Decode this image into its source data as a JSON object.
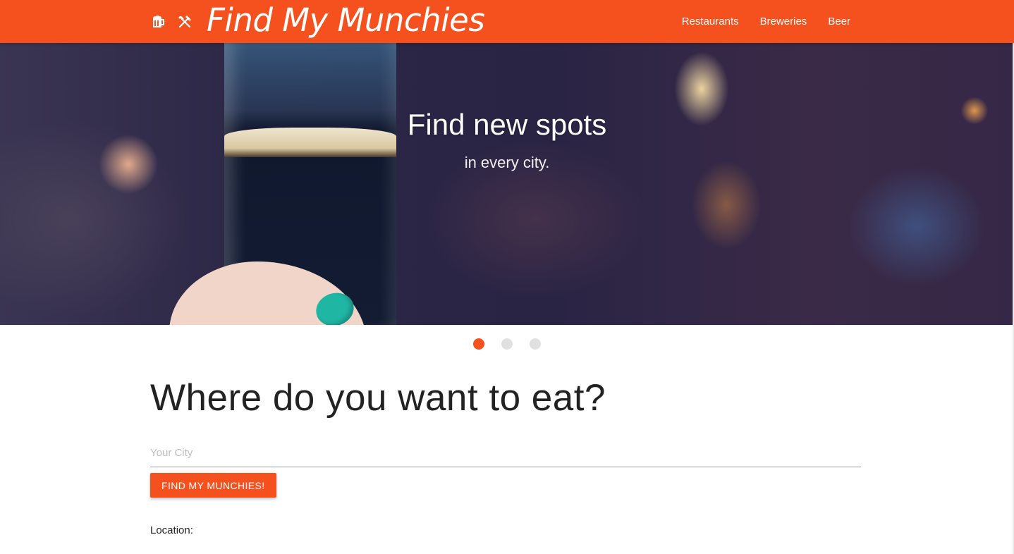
{
  "header": {
    "brand_title": "Find My Munchies",
    "brand_icons": [
      "beer-mug-icon",
      "fork-knife-icon"
    ],
    "nav": [
      {
        "label": "Restaurants"
      },
      {
        "label": "Breweries"
      },
      {
        "label": "Beer"
      }
    ]
  },
  "hero": {
    "title": "Find new spots",
    "subtitle": "in every city."
  },
  "slider": {
    "slide_count": 3,
    "active_index": 0
  },
  "search": {
    "heading": "Where do you want to eat?",
    "city_placeholder": "Your City",
    "city_value": "",
    "button_label": "FIND MY MUNCHIES!"
  },
  "result": {
    "location_label": "Location:"
  },
  "colors": {
    "accent": "#f4511e",
    "inactive_dot": "#e0e0e0",
    "heading_text": "#222222"
  }
}
